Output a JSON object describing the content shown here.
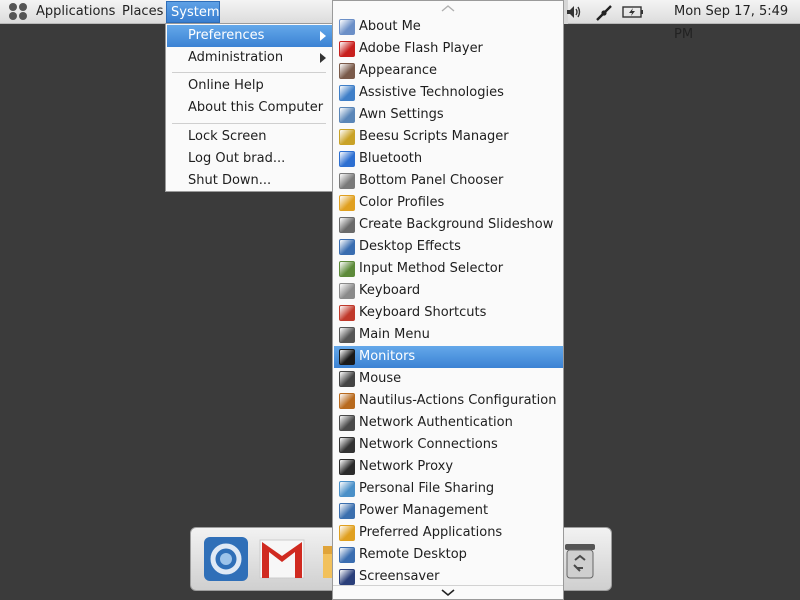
{
  "top_panel": {
    "applications_label": "Applications",
    "places_label": "Places",
    "system_label": "System",
    "clock": "Mon Sep 17,  5:49 PM"
  },
  "system_menu": {
    "items": [
      {
        "label": "Preferences",
        "has_submenu": true,
        "active": true
      },
      {
        "label": "Administration",
        "has_submenu": true
      },
      {
        "label": "Online Help"
      },
      {
        "label": "About this Computer"
      },
      {
        "label": "Lock Screen"
      },
      {
        "label": "Log Out brad..."
      },
      {
        "label": "Shut Down..."
      }
    ]
  },
  "preferences_menu": {
    "items": [
      {
        "label": "About Me",
        "icon": "about-me-icon",
        "color": "#6b8fc7"
      },
      {
        "label": "Adobe Flash Player",
        "icon": "flash-icon",
        "color": "#c8201e"
      },
      {
        "label": "Appearance",
        "icon": "appearance-icon",
        "color": "#7a5a4a"
      },
      {
        "label": "Assistive Technologies",
        "icon": "accessibility-icon",
        "color": "#3f7fc8"
      },
      {
        "label": "Awn Settings",
        "icon": "awn-icon",
        "color": "#5a86b8"
      },
      {
        "label": "Beesu Scripts Manager",
        "icon": "beesu-icon",
        "color": "#c9a227"
      },
      {
        "label": "Bluetooth",
        "icon": "bluetooth-icon",
        "color": "#2d6fd1"
      },
      {
        "label": "Bottom Panel Chooser",
        "icon": "panel-chooser-icon",
        "color": "#7a7a7a"
      },
      {
        "label": "Color Profiles",
        "icon": "color-profiles-icon",
        "color": "#e0a020"
      },
      {
        "label": "Create Background Slideshow",
        "icon": "slideshow-icon",
        "color": "#6a6a6a"
      },
      {
        "label": "Desktop Effects",
        "icon": "desktop-effects-icon",
        "color": "#3a6db0"
      },
      {
        "label": "Input Method Selector",
        "icon": "input-method-icon",
        "color": "#5d8a3a"
      },
      {
        "label": "Keyboard",
        "icon": "keyboard-icon",
        "color": "#8a8a8a"
      },
      {
        "label": "Keyboard Shortcuts",
        "icon": "keyboard-shortcuts-icon",
        "color": "#c0392b"
      },
      {
        "label": "Main Menu",
        "icon": "main-menu-icon",
        "color": "#555555"
      },
      {
        "label": "Monitors",
        "icon": "monitor-icon",
        "color": "#1a1a1a",
        "active": true
      },
      {
        "label": "Mouse",
        "icon": "mouse-icon",
        "color": "#444444"
      },
      {
        "label": "Nautilus-Actions Configuration",
        "icon": "nautilus-actions-icon",
        "color": "#b86a1e"
      },
      {
        "label": "Network Authentication",
        "icon": "key-icon",
        "color": "#4a4a4a"
      },
      {
        "label": "Network Connections",
        "icon": "network-connections-icon",
        "color": "#333333"
      },
      {
        "label": "Network Proxy",
        "icon": "network-proxy-icon",
        "color": "#2b2b2b"
      },
      {
        "label": "Personal File Sharing",
        "icon": "file-sharing-icon",
        "color": "#4a90c8"
      },
      {
        "label": "Power Management",
        "icon": "power-icon",
        "color": "#3b6fae"
      },
      {
        "label": "Preferred Applications",
        "icon": "preferred-apps-icon",
        "color": "#e0a020"
      },
      {
        "label": "Remote Desktop",
        "icon": "remote-desktop-icon",
        "color": "#3a6db0"
      },
      {
        "label": "Screensaver",
        "icon": "screensaver-icon",
        "color": "#2a3f7a"
      }
    ]
  },
  "dock": {
    "items": [
      {
        "name": "chromium-icon"
      },
      {
        "name": "gmail-icon"
      },
      {
        "name": "folder-icon"
      },
      {
        "name": "trash-icon"
      }
    ]
  },
  "colors": {
    "highlight": "#3b82d4",
    "desktop": "#3b3b3b"
  }
}
